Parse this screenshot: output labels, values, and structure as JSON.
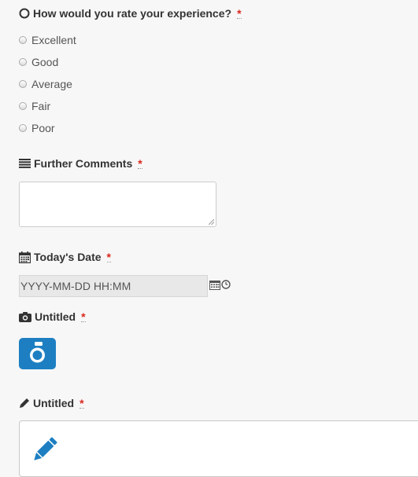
{
  "rating": {
    "question": "How would you rate your experience?",
    "required_mark": "*",
    "options": [
      "Excellent",
      "Good",
      "Average",
      "Fair",
      "Poor"
    ]
  },
  "comments": {
    "label": "Further Comments",
    "required_mark": "*",
    "value": ""
  },
  "date": {
    "label": "Today's Date",
    "required_mark": "*",
    "placeholder": "YYYY-MM-DD HH:MM"
  },
  "photo": {
    "label": "Untitled",
    "required_mark": "*"
  },
  "signature": {
    "label": "Untitled",
    "required_mark": "*"
  },
  "colors": {
    "accent_blue": "#1d7fc2",
    "required_red": "#d9261c"
  },
  "icons": {
    "rating": "radio-circle-icon",
    "comments": "list-lines-icon",
    "date": "calendar-icon",
    "photo": "camera-icon",
    "signature": "pencil-icon"
  }
}
